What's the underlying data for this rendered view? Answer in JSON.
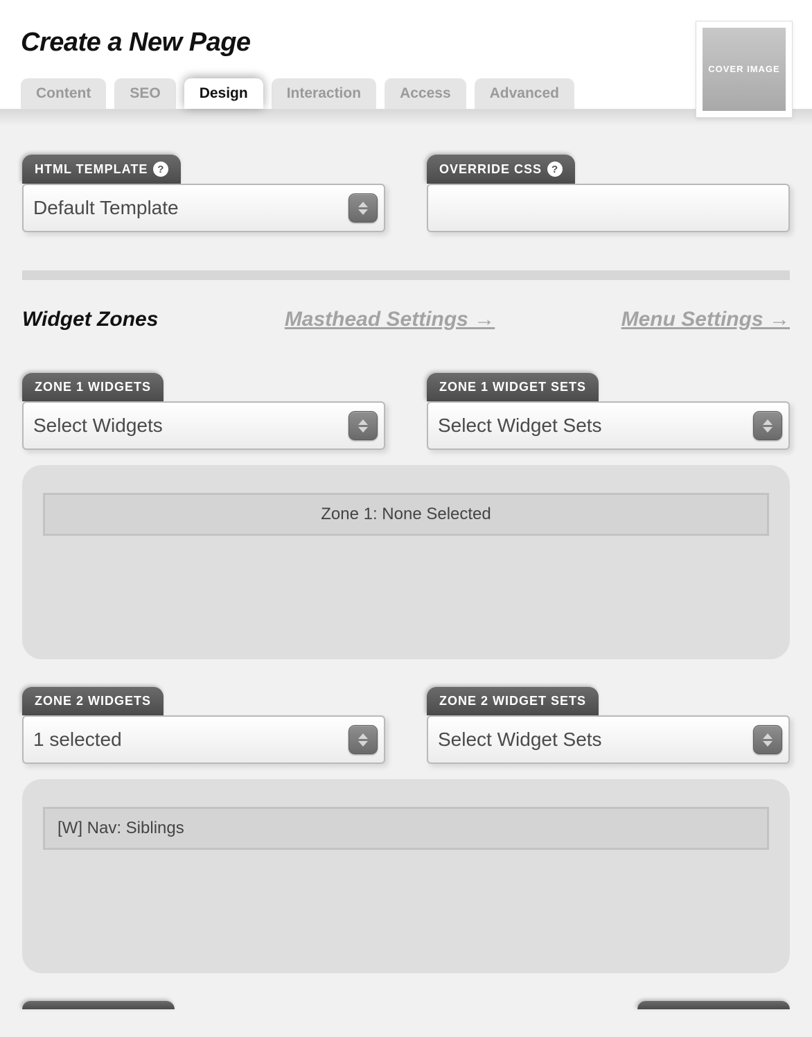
{
  "header": {
    "title": "Create a New Page",
    "cover_label": "COVER IMAGE"
  },
  "tabs": [
    {
      "label": "Content",
      "active": false
    },
    {
      "label": "SEO",
      "active": false
    },
    {
      "label": "Design",
      "active": true
    },
    {
      "label": "Interaction",
      "active": false
    },
    {
      "label": "Access",
      "active": false
    },
    {
      "label": "Advanced",
      "active": false
    }
  ],
  "fields": {
    "html_template": {
      "tag": "HTML TEMPLATE",
      "value": "Default Template"
    },
    "override_css": {
      "tag": "OVERRIDE CSS",
      "value": ""
    }
  },
  "section_nav": {
    "current": "Widget Zones",
    "link_masthead": "Masthead Settings",
    "link_menu": "Menu Settings",
    "arrow": "→"
  },
  "zones": {
    "z1_widgets": {
      "tag": "ZONE 1 WIDGETS",
      "value": "Select Widgets"
    },
    "z1_sets": {
      "tag": "ZONE 1 WIDGET SETS",
      "value": "Select Widget Sets"
    },
    "z1_panel_text": "Zone 1: None Selected",
    "z2_widgets": {
      "tag": "ZONE 2 WIDGETS",
      "value": "1 selected"
    },
    "z2_sets": {
      "tag": "ZONE 2 WIDGET SETS",
      "value": "Select Widget Sets"
    },
    "z2_panel_item": "[W] Nav: Siblings"
  }
}
